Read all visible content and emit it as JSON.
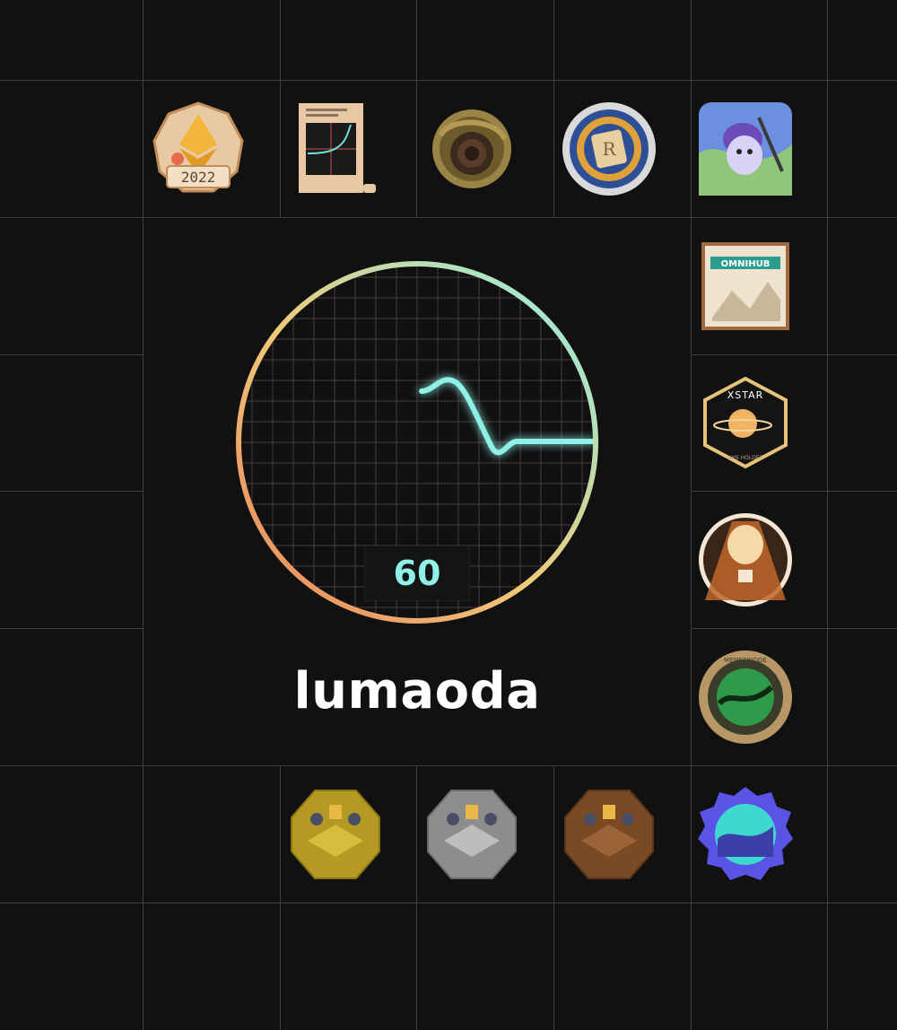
{
  "profile": {
    "username": "lumaoda",
    "score": "60"
  },
  "badges": {
    "top_row": [
      {
        "name": "2022-badge",
        "text": "2022"
      },
      {
        "name": "graph-scroll-badge"
      },
      {
        "name": "dragon-coin-badge"
      },
      {
        "name": "scroll-seal-badge"
      },
      {
        "name": "miner-character-badge"
      }
    ],
    "right_column": [
      {
        "name": "omnihub-badge",
        "text": "OMNIHUB"
      },
      {
        "name": "xstar-badge",
        "text": "XSTAR",
        "subtext": "XHS HOLDER"
      },
      {
        "name": "hot-air-balloon-badge"
      },
      {
        "name": "memebridge-badge",
        "text": "MEMEBRIDGE"
      },
      {
        "name": "meme-bridge-blue-badge"
      }
    ],
    "bottom_row": [
      {
        "name": "gold-tier-badge"
      },
      {
        "name": "silver-tier-badge"
      },
      {
        "name": "bronze-tier-badge"
      }
    ]
  },
  "colors": {
    "background": "#111111",
    "grid_line": "#3e3e3e",
    "accent_teal": "#8ef0e6",
    "ring_gradient": [
      "#e8825a",
      "#f0c978",
      "#8ef0e6"
    ]
  }
}
